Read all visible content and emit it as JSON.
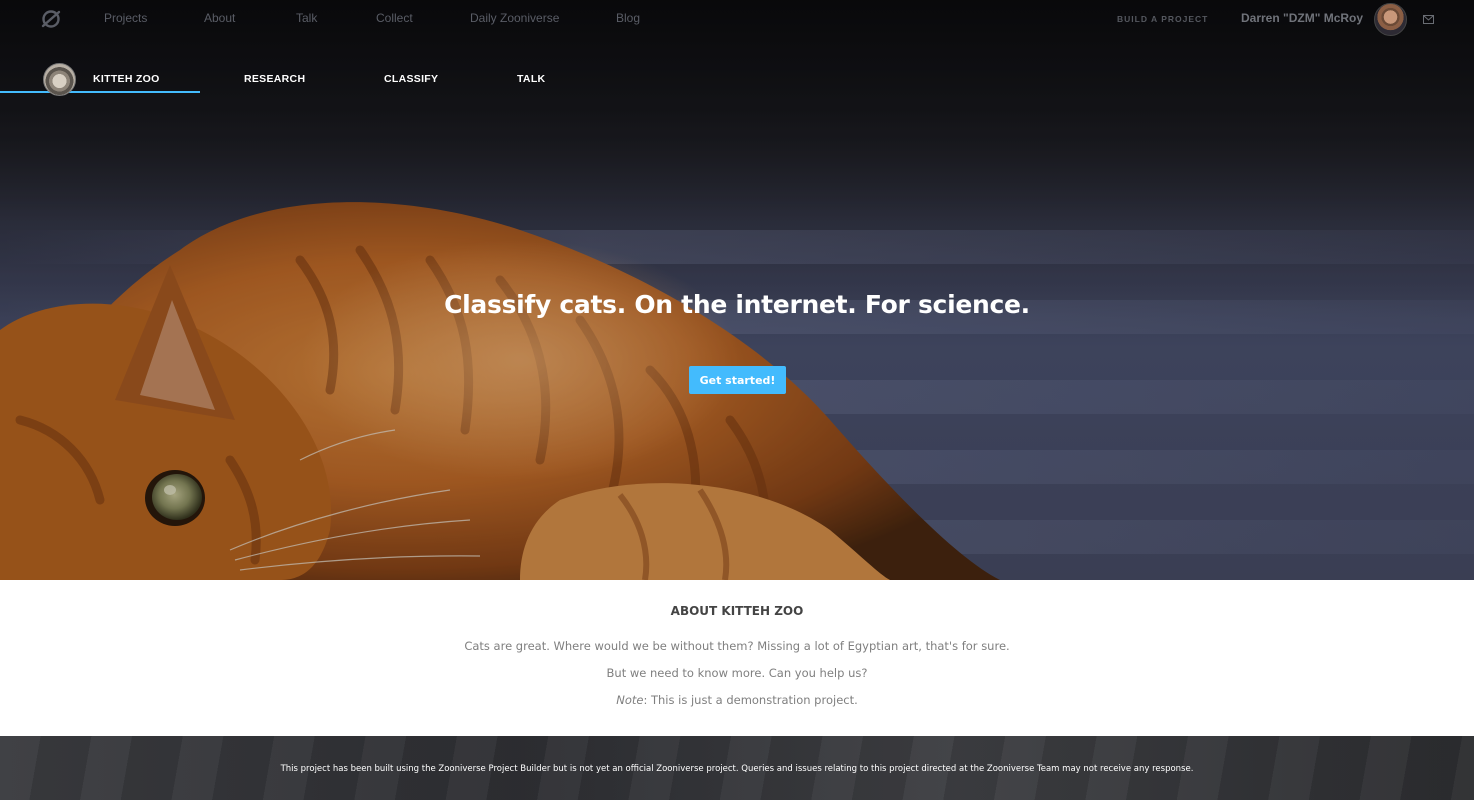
{
  "site_nav": {
    "logo_icon": "zooniverse-logo-icon",
    "links": [
      "Projects",
      "About",
      "Talk",
      "Collect",
      "Daily Zooniverse",
      "Blog"
    ],
    "build_project": "BUILD A PROJECT",
    "user_name": "Darren \"DZM\" McRoy",
    "mail_icon": "envelope-icon"
  },
  "project_nav": {
    "title": "KITTEH ZOO",
    "links": [
      "RESEARCH",
      "CLASSIFY",
      "TALK"
    ],
    "active_color": "#43bbfd"
  },
  "hero": {
    "headline": "Classify cats. On the internet. For science.",
    "cta_label": "Get started!",
    "cta_color": "#43bbfd"
  },
  "about": {
    "heading": "ABOUT KITTEH ZOO",
    "paragraph_1": "Cats are great. Where would we be without them? Missing a lot of Egyptian art, that's for sure.",
    "paragraph_2": "But we need to know more. Can you help us?",
    "note_label": "Note",
    "note_text": ": This is just a demonstration project."
  },
  "footer": {
    "disclaimer": "This project has been built using the Zooniverse Project Builder but is not yet an official Zooniverse project. Queries and issues relating to this project directed at the Zooniverse Team may not receive any response."
  }
}
